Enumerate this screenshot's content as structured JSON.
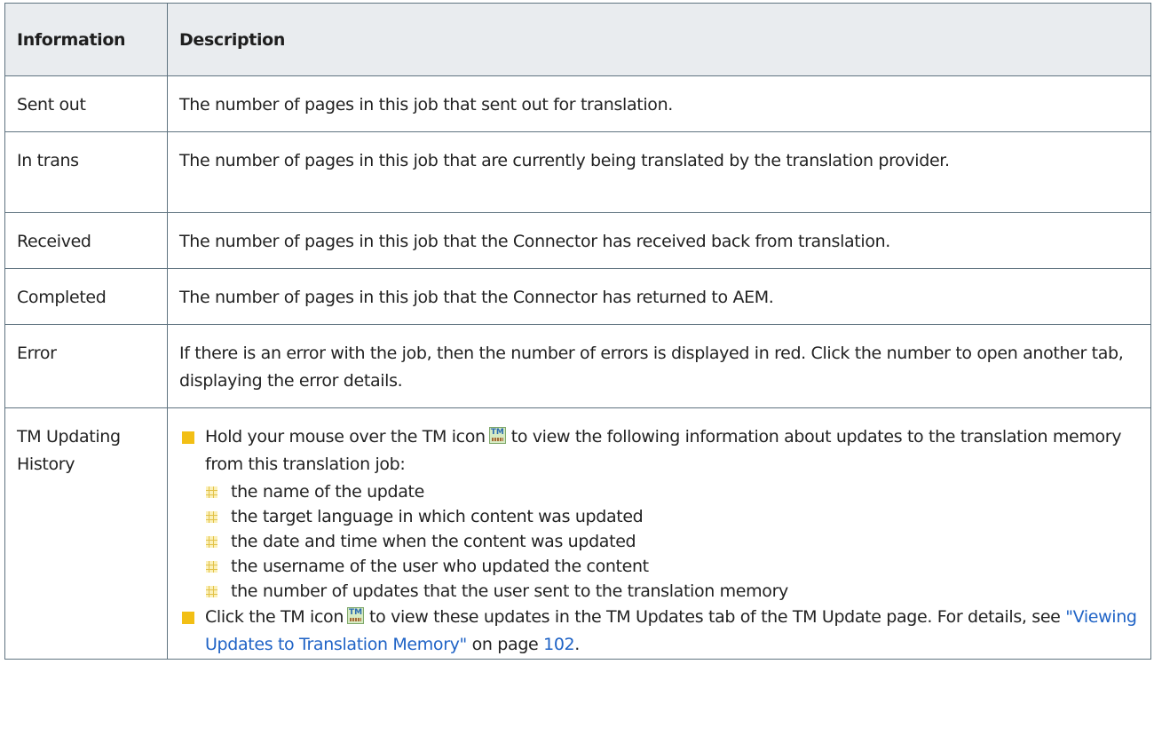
{
  "headers": [
    "Information",
    "Description"
  ],
  "rows": [
    {
      "info": "Sent out",
      "desc": "The number of pages in this job that sent out for translation."
    },
    {
      "info": "In trans",
      "desc": "The number of pages in this job that are currently being translated by the translation provider."
    },
    {
      "info": "Received",
      "desc": "The number of pages in this job that the Connector has received back from translation."
    },
    {
      "info": "Completed",
      "desc": "The number of pages in this job that the Connector has returned to AEM."
    },
    {
      "info": "Error",
      "desc": "If there is an error with the job, then the number of errors is displayed in red. Click the number to open another tab, displaying the error details."
    }
  ],
  "tm_row": {
    "info": "TM Updating History",
    "bullet1_before": "Hold your mouse over the TM icon",
    "bullet1_after": "to view the following information about updates to the translation memory from this translation job:",
    "sub_items": [
      "the name of the update",
      "the target language in which content was updated",
      "the date and time when the content was updated",
      "the username of the user who updated the content",
      "the number of updates that the user sent to the translation memory"
    ],
    "bullet2_before": "Click the TM icon",
    "bullet2_mid": "to view these updates in the TM Updates tab of the TM Update page. For details, see",
    "link_text": "\"Viewing Updates to Translation Memory\"",
    "on_page": "on page",
    "page_number": "102",
    "end": ".",
    "icon_text": "TM"
  },
  "colors": {
    "bullet": "#f2bf15",
    "link": "#1f63c6",
    "header_bg": "#e9ecef",
    "border": "#5f7380"
  }
}
